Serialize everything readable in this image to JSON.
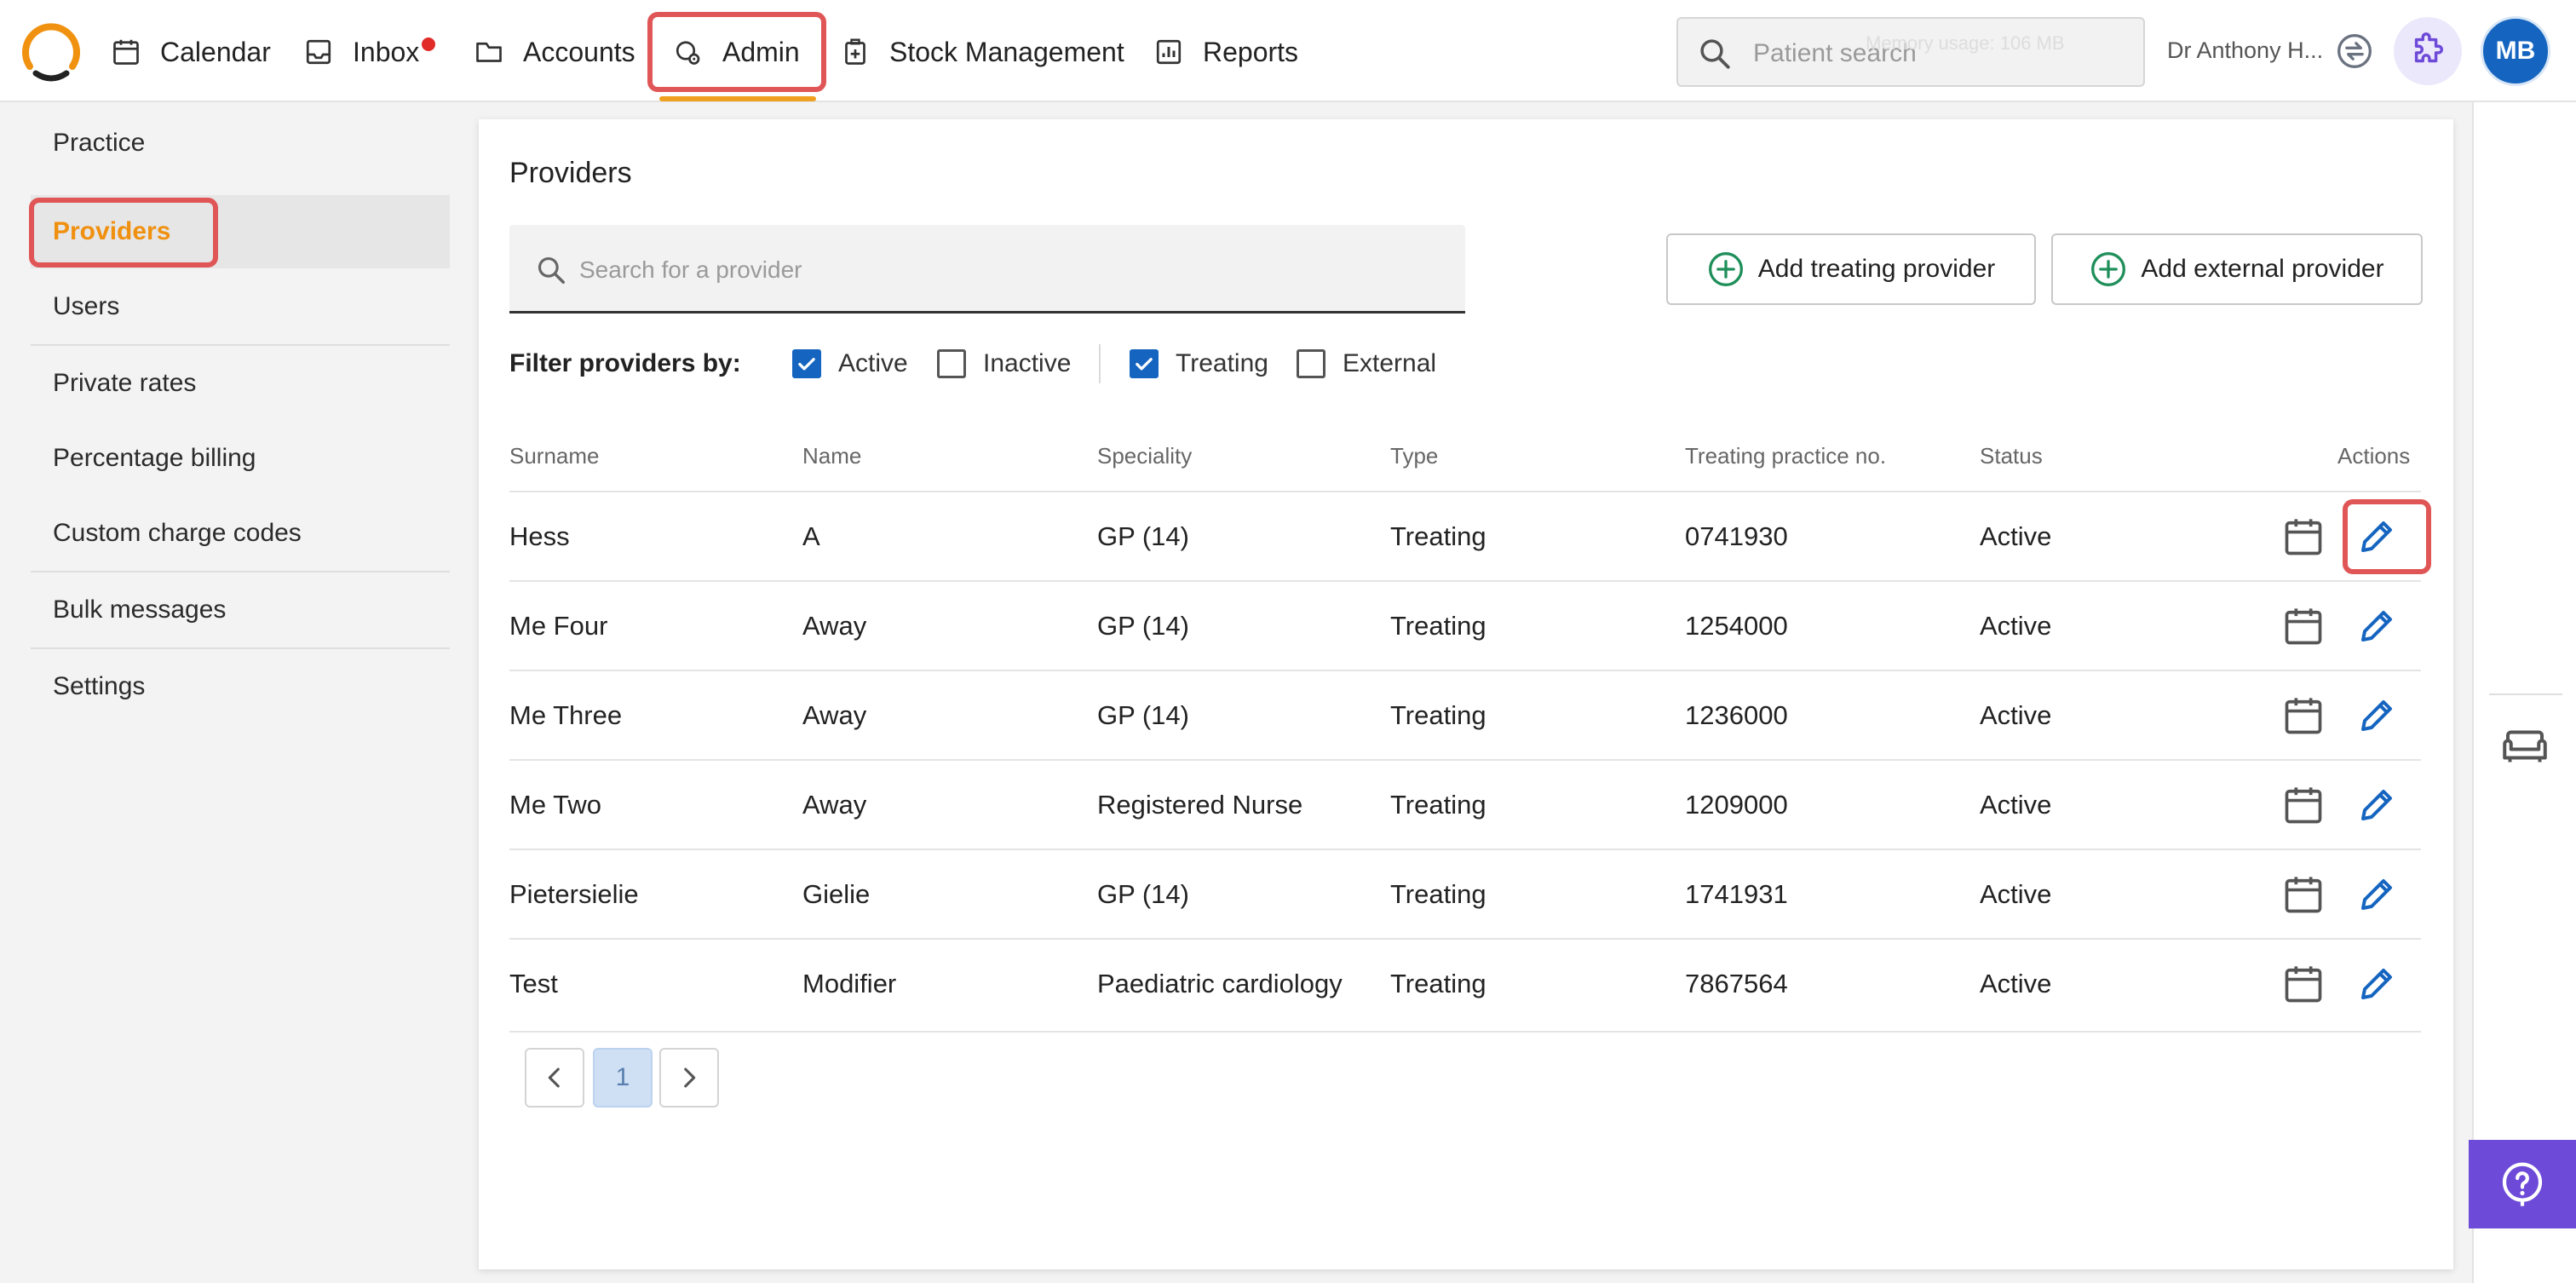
{
  "nav": {
    "items": [
      {
        "label": "Calendar",
        "icon": "calendar-icon"
      },
      {
        "label": "Inbox",
        "icon": "inbox-icon",
        "badge_color": "#e02b27"
      },
      {
        "label": "Accounts",
        "icon": "folder-icon"
      },
      {
        "label": "Admin",
        "icon": "admin-gear-icon",
        "active": true
      },
      {
        "label": "Stock Management",
        "icon": "stock-icon"
      },
      {
        "label": "Reports",
        "icon": "reports-icon"
      }
    ],
    "active_underline_color": "#f0a020"
  },
  "header": {
    "search_placeholder": "Patient search",
    "memory_note": "Memory usage: 106 MB",
    "user_name": "Dr Anthony H...",
    "avatar_initials": "MB",
    "avatar_color": "#1565c0"
  },
  "sidebar": {
    "items": [
      {
        "label": "Practice"
      },
      {
        "label": "Providers",
        "active": true
      },
      {
        "label": "Users"
      },
      {
        "label": "Private rates"
      },
      {
        "label": "Percentage billing"
      },
      {
        "label": "Custom charge codes"
      },
      {
        "label": "Bulk messages"
      },
      {
        "label": "Settings"
      }
    ],
    "active_color": "#f0900f"
  },
  "main": {
    "title": "Providers",
    "search_placeholder": "Search for a provider",
    "add_treating_label": "Add treating provider",
    "add_external_label": "Add external provider",
    "filter_label": "Filter providers by:",
    "filters": [
      {
        "label": "Active",
        "checked": true
      },
      {
        "label": "Inactive",
        "checked": false
      },
      {
        "label": "Treating",
        "checked": true
      },
      {
        "label": "External",
        "checked": false
      }
    ],
    "columns": [
      "Surname",
      "Name",
      "Speciality",
      "Type",
      "Treating practice no.",
      "Status",
      "Actions"
    ],
    "rows": [
      {
        "surname": "Hess",
        "name": "A",
        "speciality": "GP (14)",
        "type": "Treating",
        "practice_no": "0741930",
        "status": "Active"
      },
      {
        "surname": "Me Four",
        "name": "Away",
        "speciality": "GP (14)",
        "type": "Treating",
        "practice_no": "1254000",
        "status": "Active"
      },
      {
        "surname": "Me Three",
        "name": "Away",
        "speciality": "GP (14)",
        "type": "Treating",
        "practice_no": "1236000",
        "status": "Active"
      },
      {
        "surname": "Me Two",
        "name": "Away",
        "speciality": "Registered Nurse",
        "type": "Treating",
        "practice_no": "1209000",
        "status": "Active"
      },
      {
        "surname": "Pietersielie",
        "name": "Gielie",
        "speciality": "GP (14)",
        "type": "Treating",
        "practice_no": "1741931",
        "status": "Active"
      },
      {
        "surname": "Test",
        "name": "Modifier",
        "speciality": "Paediatric cardiology",
        "type": "Treating",
        "practice_no": "7867564",
        "status": "Active"
      }
    ],
    "pagination": {
      "current_page": "1"
    },
    "accent_color": "#1565c0",
    "add_icon_color": "#1f8f5a"
  },
  "right_rail": {
    "help_color": "#6d4ad8"
  }
}
